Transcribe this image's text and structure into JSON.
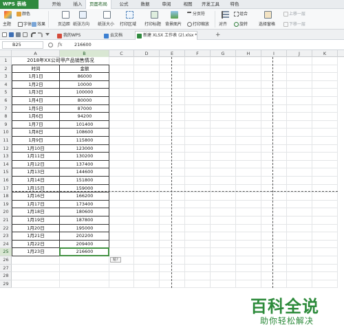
{
  "app": {
    "name": "WPS 表格"
  },
  "menu": [
    "开始",
    "插入",
    "页面布局",
    "公式",
    "数据",
    "审阅",
    "视图",
    "开发工具",
    "特色"
  ],
  "menu_active": "页面布局",
  "ribbon": {
    "theme": "主题",
    "colors": "颜色",
    "fonts": "字体",
    "effects": "效果",
    "margins": "页边距",
    "orientation": "纸张方向",
    "size": "纸张大小",
    "print_area": "打印区域",
    "print_titles": "打印标题",
    "background": "背景图片",
    "page_break": "分页符",
    "print_zoom": "打印缩放",
    "align": "对齐",
    "group": "组合",
    "rotate": "旋转",
    "selection_pane": "选择窗格",
    "bring_forward": "上移一层",
    "send_backward": "下移一层"
  },
  "tabs": [
    {
      "label": "我的WPS",
      "active": false
    },
    {
      "label": "云文档",
      "active": false
    },
    {
      "label": "新建 XLSX 工作表 (2).xlsx *",
      "active": true
    }
  ],
  "formula_bar": {
    "cell_ref": "B25",
    "fx": "fx",
    "value": "216600"
  },
  "columns": [
    "A",
    "B",
    "C",
    "D",
    "E",
    "F",
    "G",
    "H",
    "I",
    "J",
    "K"
  ],
  "selected_column": "B",
  "selected_row": 25,
  "row_count": 29,
  "sheet": {
    "title": "2018年XX公司甲产品销售情况",
    "headers": [
      "时间",
      "金额"
    ],
    "rows": [
      [
        "1月1日",
        "86000"
      ],
      [
        "1月2日",
        "10000"
      ],
      [
        "1月3日",
        "100000"
      ],
      [
        "1月4日",
        "80000"
      ],
      [
        "1月5日",
        "87000"
      ],
      [
        "1月6日",
        "94200"
      ],
      [
        "1月7日",
        "101400"
      ],
      [
        "1月8日",
        "108600"
      ],
      [
        "1月9日",
        "115800"
      ],
      [
        "1月10日",
        "123000"
      ],
      [
        "1月11日",
        "130200"
      ],
      [
        "1月12日",
        "137400"
      ],
      [
        "1月13日",
        "144600"
      ],
      [
        "1月14日",
        "151800"
      ],
      [
        "1月15日",
        "159000"
      ],
      [
        "1月16日",
        "166200"
      ],
      [
        "1月17日",
        "173400"
      ],
      [
        "1月18日",
        "180600"
      ],
      [
        "1月19日",
        "187800"
      ],
      [
        "1月20日",
        "195000"
      ],
      [
        "1月21日",
        "202200"
      ],
      [
        "1月22日",
        "209400"
      ],
      [
        "1月23日",
        "216600"
      ]
    ]
  },
  "paste_tag": "粘?",
  "watermark": {
    "logo": "百科全说",
    "sub": "助你轻松解决"
  },
  "colors": {
    "brand": "#2f8a3e",
    "selection": "#3f8f3f"
  }
}
